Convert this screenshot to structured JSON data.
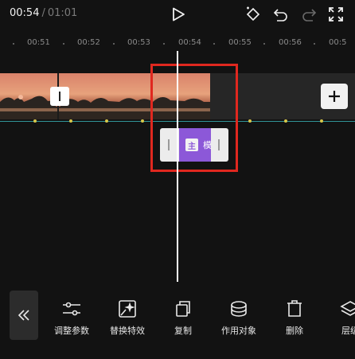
{
  "header": {
    "current_time": "00:54",
    "separator": "/",
    "total_time": "01:01",
    "icons": [
      "play-icon",
      "keyframe-diamond-icon",
      "undo-icon",
      "redo-icon",
      "fullscreen-icon"
    ]
  },
  "ruler": {
    "ticks": [
      "00:51",
      "00:52",
      "00:53",
      "00:54",
      "00:55",
      "00:56",
      "00:5"
    ]
  },
  "effect_clip": {
    "badge": "主",
    "name": "模"
  },
  "toolbar": {
    "items": [
      {
        "label": "调整参数",
        "icon": "sliders-icon"
      },
      {
        "label": "替换特效",
        "icon": "replace-effect-icon"
      },
      {
        "label": "复制",
        "icon": "copy-icon"
      },
      {
        "label": "作用对象",
        "icon": "target-object-icon"
      },
      {
        "label": "删除",
        "icon": "trash-icon"
      },
      {
        "label": "层级",
        "icon": "layers-icon"
      }
    ]
  },
  "colors": {
    "highlight": "#e0281f",
    "effect_purple": "#8c58d8",
    "keyframe_line": "#3ecbd1",
    "keyframe_dot": "#d8c84a"
  }
}
